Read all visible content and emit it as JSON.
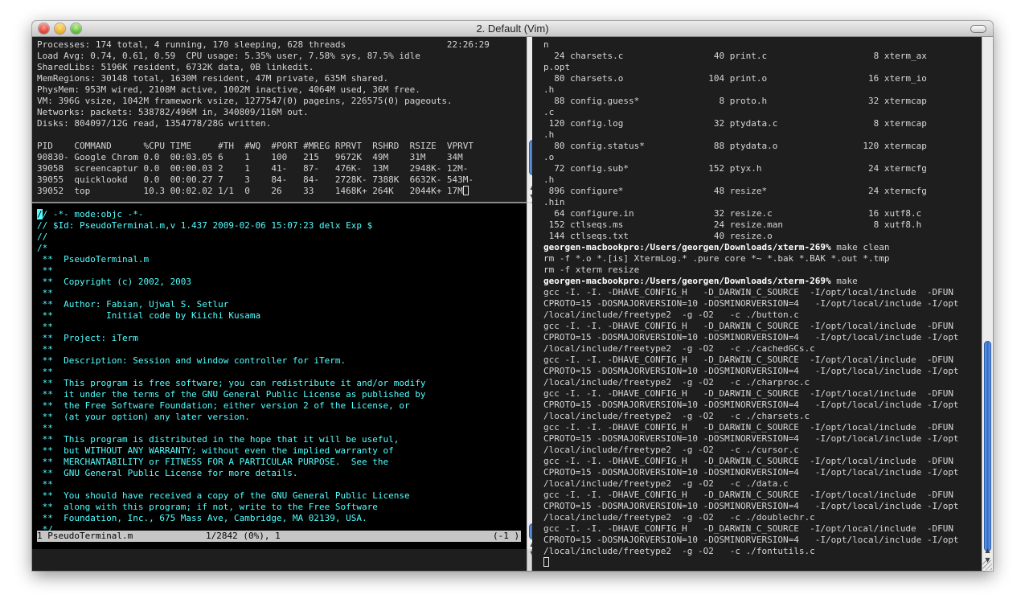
{
  "window": {
    "title": "2. Default (Vim)"
  },
  "top_pane": {
    "lines": [
      "Processes: 174 total, 4 running, 170 sleeping, 628 threads                   22:26:29",
      "Load Avg: 0.74, 0.61, 0.59  CPU usage: 5.35% user, 7.58% sys, 87.5% idle",
      "SharedLibs: 5196K resident, 6732K data, 0B linkedit.",
      "MemRegions: 30148 total, 1630M resident, 47M private, 635M shared.",
      "PhysMem: 953M wired, 2108M active, 1002M inactive, 4064M used, 36M free.",
      "VM: 396G vsize, 1042M framework vsize, 1277547(0) pageins, 226575(0) pageouts.",
      "Networks: packets: 538782/496M in, 340809/116M out.",
      "Disks: 804097/12G read, 1354778/28G written.",
      "",
      "PID    COMMAND      %CPU TIME     #TH  #WQ  #PORT #MREG RPRVT  RSHRD  RSIZE  VPRVT",
      "90830- Google Chrom 0.0  00:03.05 6    1    100   215   9672K  49M    31M    34M",
      "39058  screencaptur 0.0  00:00.03 2    1    41-   87-   476K-  13M    2948K- 12M-",
      "39055  quicklookd   0.0  00:00.27 7    3    84-   84-   2728K- 7388K  6632K- 543M-",
      "39052  top          10.3 00:02.02 1/1  0    26    33    1468K+ 264K   2044K+ 17M"
    ]
  },
  "vim": {
    "lines": [
      "// -*- mode:objc -*-",
      "// $Id: PseudoTerminal.m,v 1.437 2009-02-06 15:07:23 delx Exp $",
      "//",
      "/*",
      " **  PseudoTerminal.m",
      " **",
      " **  Copyright (c) 2002, 2003",
      " **",
      " **  Author: Fabian, Ujwal S. Setlur",
      " **          Initial code by Kiichi Kusama",
      " **",
      " **  Project: iTerm",
      " **",
      " **  Description: Session and window controller for iTerm.",
      " **",
      " **  This program is free software; you can redistribute it and/or modify",
      " **  it under the terms of the GNU General Public License as published by",
      " **  the Free Software Foundation; either version 2 of the License, or",
      " **  (at your option) any later version.",
      " **",
      " **  This program is distributed in the hope that it will be useful,",
      " **  but WITHOUT ANY WARRANTY; without even the implied warranty of",
      " **  MERCHANTABILITY or FITNESS FOR A PARTICULAR PURPOSE.  See the",
      " **  GNU General Public License for more details.",
      " **",
      " **  You should have received a copy of the GNU General Public License",
      " **  along with this program; if not, write to the Free Software",
      " **  Foundation, Inc., 675 Mass Ave, Cambridge, MA 02139, USA.",
      " */"
    ],
    "status_left": "1 PseudoTerminal.m",
    "status_pos": "1/2842 (0%), 1",
    "status_right": "(-1 )"
  },
  "right_pane": {
    "listing": [
      "n",
      "  24 charsets.c                 40 print.c                    8 xterm_ax",
      "p.opt",
      "  80 charsets.o                104 print.o                   16 xterm_io",
      ".h",
      "  88 config.guess*               8 proto.h                   32 xtermcap",
      ".c",
      " 120 config.log                 32 ptydata.c                  8 xtermcap",
      ".h",
      "  80 config.status*             88 ptydata.o                120 xtermcap",
      ".o",
      "  72 config.sub*               152 ptyx.h                    24 xtermcfg",
      ".h",
      " 896 configure*                 48 resize*                   24 xtermcfg",
      ".hin",
      "  64 configure.in               32 resize.c                  16 xutf8.c",
      " 152 ctlseqs.ms                 24 resize.man                 8 xutf8.h",
      " 144 ctlseqs.txt                40 resize.o"
    ],
    "prompt1": "georgen-macbookpro:/Users/georgen/Downloads/xterm-269%",
    "cmd1": " make clean",
    "clean_output": [
      "rm -f *.o *.[is] XtermLog.* .pure core *~ *.bak *.BAK *.out *.tmp",
      "rm -f xterm resize"
    ],
    "prompt2": "georgen-macbookpro:/Users/georgen/Downloads/xterm-269%",
    "cmd2": " make",
    "make_output": [
      "gcc -I. -I. -DHAVE_CONFIG_H   -D_DARWIN_C_SOURCE  -I/opt/local/include  -DFUN",
      "CPROTO=15 -DOSMAJORVERSION=10 -DOSMINORVERSION=4   -I/opt/local/include -I/opt",
      "/local/include/freetype2  -g -O2   -c ./button.c",
      "gcc -I. -I. -DHAVE_CONFIG_H   -D_DARWIN_C_SOURCE  -I/opt/local/include  -DFUN",
      "CPROTO=15 -DOSMAJORVERSION=10 -DOSMINORVERSION=4   -I/opt/local/include -I/opt",
      "/local/include/freetype2  -g -O2   -c ./cachedGCs.c",
      "gcc -I. -I. -DHAVE_CONFIG_H   -D_DARWIN_C_SOURCE  -I/opt/local/include  -DFUN",
      "CPROTO=15 -DOSMAJORVERSION=10 -DOSMINORVERSION=4   -I/opt/local/include -I/opt",
      "/local/include/freetype2  -g -O2   -c ./charproc.c",
      "gcc -I. -I. -DHAVE_CONFIG_H   -D_DARWIN_C_SOURCE  -I/opt/local/include  -DFUN",
      "CPROTO=15 -DOSMAJORVERSION=10 -DOSMINORVERSION=4   -I/opt/local/include -I/opt",
      "/local/include/freetype2  -g -O2   -c ./charsets.c",
      "gcc -I. -I. -DHAVE_CONFIG_H   -D_DARWIN_C_SOURCE  -I/opt/local/include  -DFUN",
      "CPROTO=15 -DOSMAJORVERSION=10 -DOSMINORVERSION=4   -I/opt/local/include -I/opt",
      "/local/include/freetype2  -g -O2   -c ./cursor.c",
      "gcc -I. -I. -DHAVE_CONFIG_H   -D_DARWIN_C_SOURCE  -I/opt/local/include  -DFUN",
      "CPROTO=15 -DOSMAJORVERSION=10 -DOSMINORVERSION=4   -I/opt/local/include -I/opt",
      "/local/include/freetype2  -g -O2   -c ./data.c",
      "gcc -I. -I. -DHAVE_CONFIG_H   -D_DARWIN_C_SOURCE  -I/opt/local/include  -DFUN",
      "CPROTO=15 -DOSMAJORVERSION=10 -DOSMINORVERSION=4   -I/opt/local/include -I/opt",
      "/local/include/freetype2  -g -O2   -c ./doublechr.c",
      "gcc -I. -I. -DHAVE_CONFIG_H   -D_DARWIN_C_SOURCE  -I/opt/local/include  -DFUN",
      "CPROTO=15 -DOSMAJORVERSION=10 -DOSMINORVERSION=4   -I/opt/local/include -I/opt",
      "/local/include/freetype2  -g -O2   -c ./fontutils.c"
    ]
  },
  "icons": {
    "close": "close-icon",
    "minimize": "minimize-icon",
    "zoom": "zoom-icon",
    "up": "▲",
    "down": "▼"
  },
  "colors": {
    "terminal_bg": "#1e1e1e",
    "vim_bg": "#000000",
    "vim_text": "#53ffff",
    "scroll_thumb": "#2e6ccf"
  }
}
